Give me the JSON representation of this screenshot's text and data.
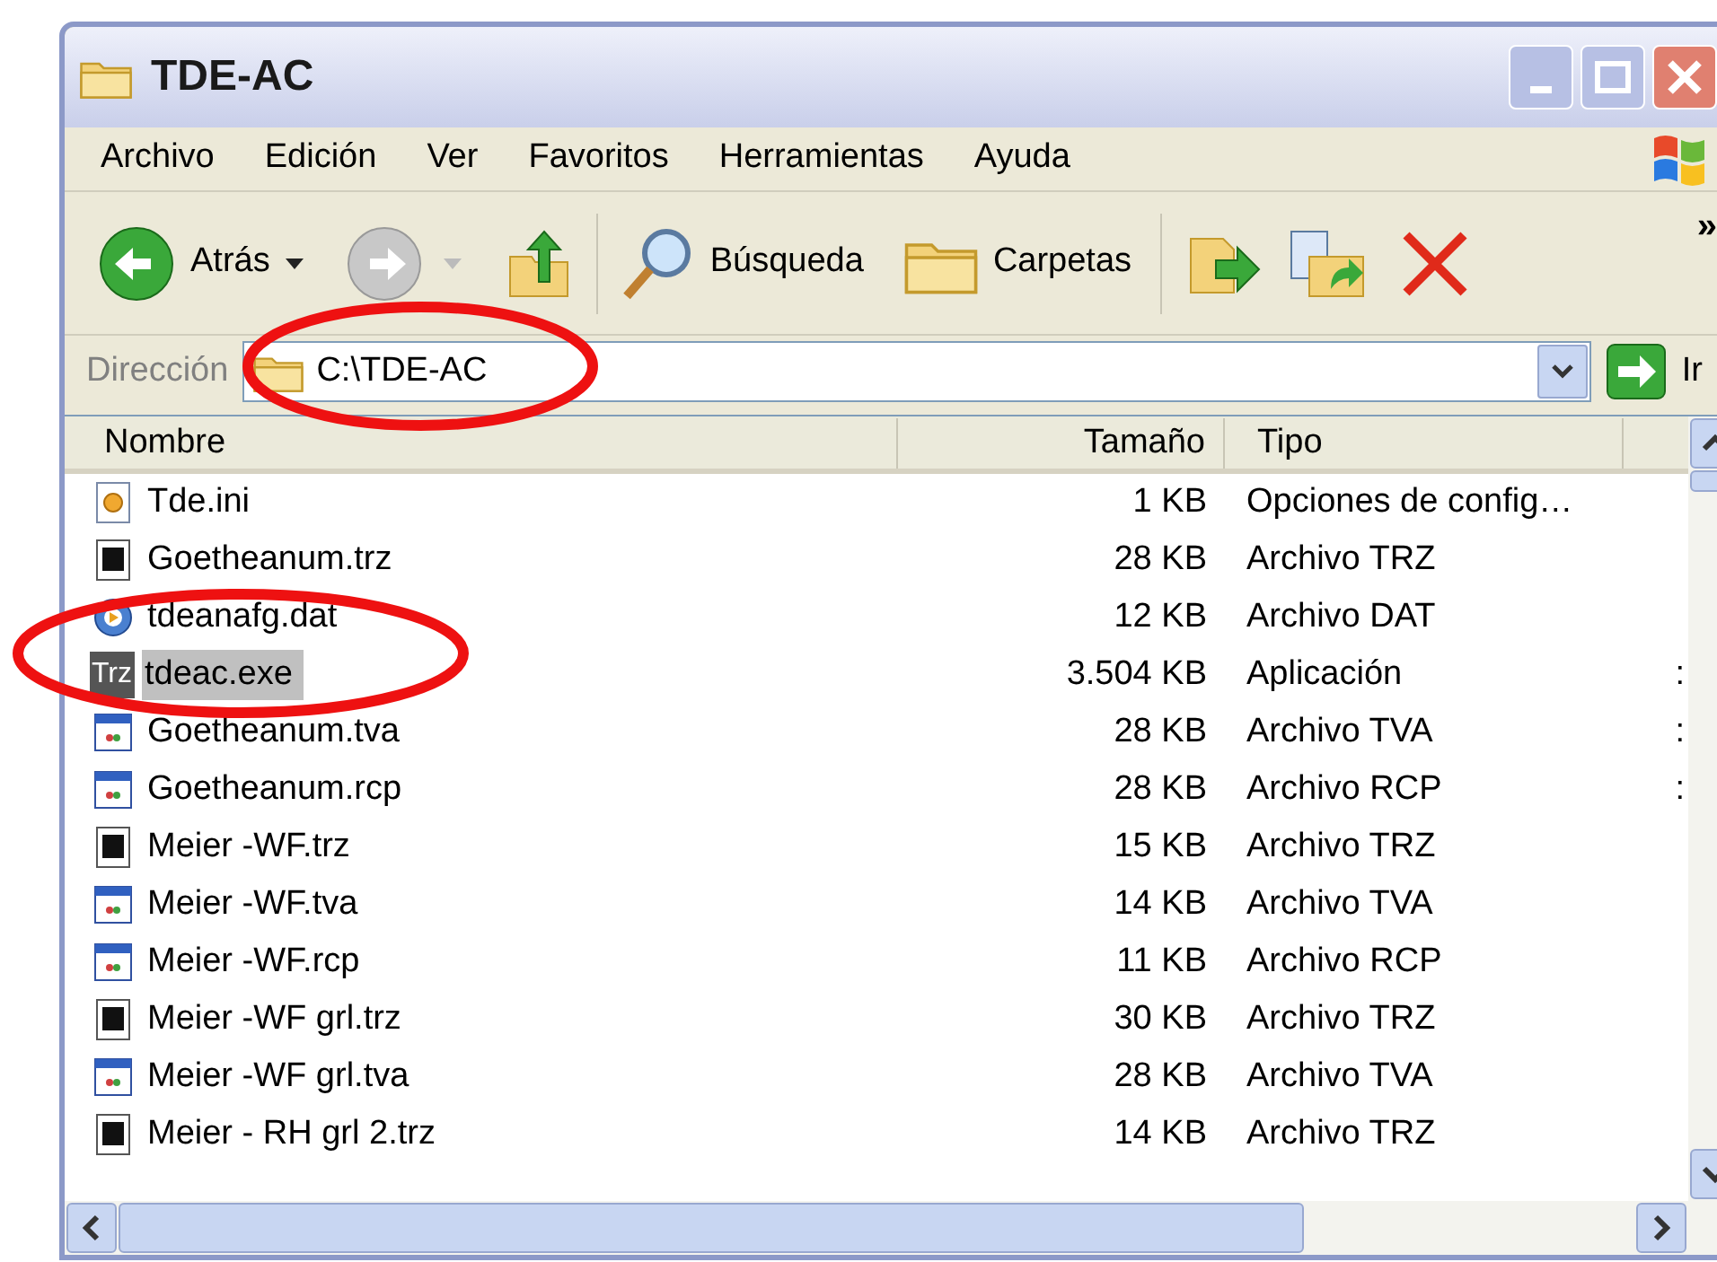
{
  "window": {
    "title": "TDE-AC"
  },
  "menu": [
    {
      "label": "Archivo"
    },
    {
      "label": "Edición"
    },
    {
      "label": "Ver"
    },
    {
      "label": "Favoritos"
    },
    {
      "label": "Herramientas"
    },
    {
      "label": "Ayuda"
    }
  ],
  "toolbar": {
    "back": {
      "label": "Atrás",
      "disabled": false
    },
    "forward": {
      "disabled": true
    },
    "search": {
      "label": "Búsqueda"
    },
    "folders": {
      "label": "Carpetas"
    },
    "overflow": "»"
  },
  "address": {
    "label": "Dirección",
    "value": "C:\\TDE-AC",
    "go": "Ir"
  },
  "table": {
    "columns": [
      "Nombre",
      "Tamaño",
      "Tipo"
    ],
    "rows": [
      {
        "name": "Tde.ini",
        "size": "1 KB",
        "type": "Opciones de config…",
        "kind": "ini",
        "selected": false
      },
      {
        "name": "Goetheanum.trz",
        "size": "28 KB",
        "type": "Archivo TRZ",
        "kind": "trz",
        "selected": false
      },
      {
        "name": "tdeanafg.dat",
        "size": "12 KB",
        "type": "Archivo DAT",
        "kind": "media",
        "selected": false
      },
      {
        "name": "tdeac.exe",
        "size": "3.504 KB",
        "type": "Aplicación",
        "kind": "exe",
        "icon_label": "Trz",
        "selected": true,
        "column_4": ":"
      },
      {
        "name": "Goetheanum.tva",
        "size": "28 KB",
        "type": "Archivo TVA",
        "kind": "window",
        "selected": false,
        "column_4": ":"
      },
      {
        "name": "Goetheanum.rcp",
        "size": "28 KB",
        "type": "Archivo RCP",
        "kind": "window",
        "selected": false,
        "column_4": ":"
      },
      {
        "name": "Meier -WF.trz",
        "size": "15 KB",
        "type": "Archivo TRZ",
        "kind": "trz",
        "selected": false
      },
      {
        "name": "Meier -WF.tva",
        "size": "14 KB",
        "type": "Archivo TVA",
        "kind": "window",
        "selected": false
      },
      {
        "name": "Meier -WF.rcp",
        "size": "11 KB",
        "type": "Archivo RCP",
        "kind": "window",
        "selected": false
      },
      {
        "name": "Meier -WF grl.trz",
        "size": "30 KB",
        "type": "Archivo TRZ",
        "kind": "trz",
        "selected": false
      },
      {
        "name": "Meier -WF grl.tva",
        "size": "28 KB",
        "type": "Archivo TVA",
        "kind": "window",
        "selected": false
      },
      {
        "name": "Meier - RH grl 2.trz",
        "size": "14 KB",
        "type": "Archivo TRZ",
        "kind": "trz",
        "selected": false
      }
    ]
  }
}
